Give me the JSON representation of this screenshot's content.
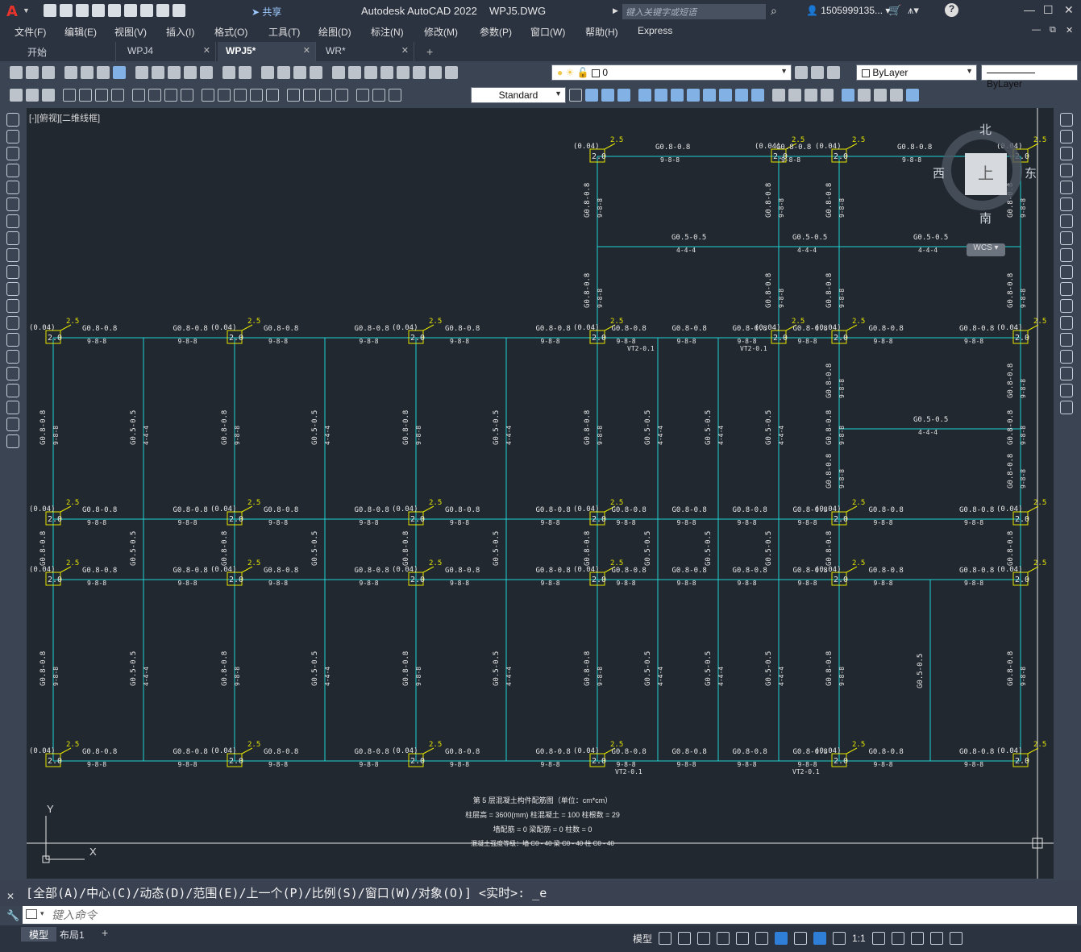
{
  "title_bar": {
    "share_label": "共享",
    "app_title": "Autodesk AutoCAD 2022",
    "doc_title": "WPJ5.DWG",
    "search_placeholder": "键入关键字或短语",
    "user_name": "1505999135...",
    "logo": "A"
  },
  "menu": [
    "文件(F)",
    "编辑(E)",
    "视图(V)",
    "插入(I)",
    "格式(O)",
    "工具(T)",
    "绘图(D)",
    "标注(N)",
    "修改(M)",
    "参数(P)",
    "窗口(W)",
    "帮助(H)",
    "Express"
  ],
  "tabs": [
    {
      "label": "开始",
      "active": false,
      "closable": false
    },
    {
      "label": "WPJ4",
      "active": false,
      "closable": true
    },
    {
      "label": "WPJ5*",
      "active": true,
      "closable": true
    },
    {
      "label": "WR*",
      "active": false,
      "closable": true
    }
  ],
  "layer_combo": {
    "value": "0"
  },
  "color_combo": {
    "value": "ByLayer"
  },
  "linetype_combo": {
    "value": "ByLayer"
  },
  "style_combo": {
    "value": "Standard"
  },
  "viewport": {
    "label": "[-][俯视][二维线框]",
    "viewcube": {
      "top": "上",
      "north": "北",
      "south": "南",
      "east": "东",
      "west": "西",
      "wcs": "WCS"
    },
    "info": {
      "line1": "第 5 层混凝土构件配筋图（单位：cm*cm）",
      "line2": "柱层高 = 3600(mm) 柱混凝土 = 100 柱根数 = 29",
      "line3": "墙配筋 = 0    梁配筋 = 0    柱数 = 0",
      "line4": "混凝土强度等级：墙 C0 - 40  梁 C0 - 40  柱 C0 - 40"
    },
    "ucs": {
      "x": "X",
      "y": "Y"
    }
  },
  "command": {
    "history": "[全部(A)/中心(C)/动态(D)/范围(E)/上一个(P)/比例(S)/窗口(W)/对象(O)] <实时>: _e",
    "placeholder": "键入命令"
  },
  "layout_tabs": [
    {
      "label": "模型",
      "active": true
    },
    {
      "label": "布局1",
      "active": false
    }
  ],
  "status": {
    "model": "模型",
    "scale": "1:1"
  },
  "colors": {
    "cyan": "#1fd3d3",
    "yellow": "#e6e600",
    "white": "#e6e6e6",
    "bg": "#212830"
  },
  "drawing": {
    "col_label_tl": "(0.04)",
    "col_value": "2.0",
    "beam_label_main": "G0.8-0.8",
    "beam_label_sec": "G0.5-0.5",
    "beam_sub_main": "9-8-8",
    "beam_sub_sec": "4-4-4",
    "top_tag": "2.5",
    "vt_label": "VT2-0.1"
  }
}
